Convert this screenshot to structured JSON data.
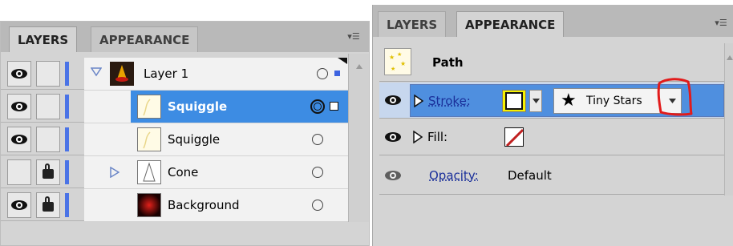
{
  "layers_panel": {
    "tabs": [
      {
        "label": "LAYERS",
        "active": true
      },
      {
        "label": "APPEARANCE",
        "active": false
      }
    ],
    "rows": [
      {
        "label": "Layer 1",
        "visible": true,
        "locked": false,
        "expanded": true,
        "selected": false
      },
      {
        "label": "Squiggle",
        "visible": true,
        "locked": false,
        "selected": true
      },
      {
        "label": "Squiggle",
        "visible": true,
        "locked": false,
        "selected": false
      },
      {
        "label": "Cone",
        "visible": false,
        "locked": true,
        "collapsed": true,
        "selected": false
      },
      {
        "label": "Background",
        "visible": true,
        "locked": true,
        "selected": false
      }
    ],
    "layer_color": "#4a73e6",
    "selection_color": "#3d8ce3"
  },
  "appearance_panel": {
    "tabs": [
      {
        "label": "LAYERS",
        "active": false
      },
      {
        "label": "APPEARANCE",
        "active": true
      }
    ],
    "object_type": "Path",
    "stroke": {
      "label": "Stroke:",
      "brush": "Tiny Stars",
      "color": "#ffff00"
    },
    "fill": {
      "label": "Fill:",
      "value": "none"
    },
    "opacity": {
      "label": "Opacity:",
      "value": "Default"
    },
    "annotation_color": "#e21b1b"
  }
}
